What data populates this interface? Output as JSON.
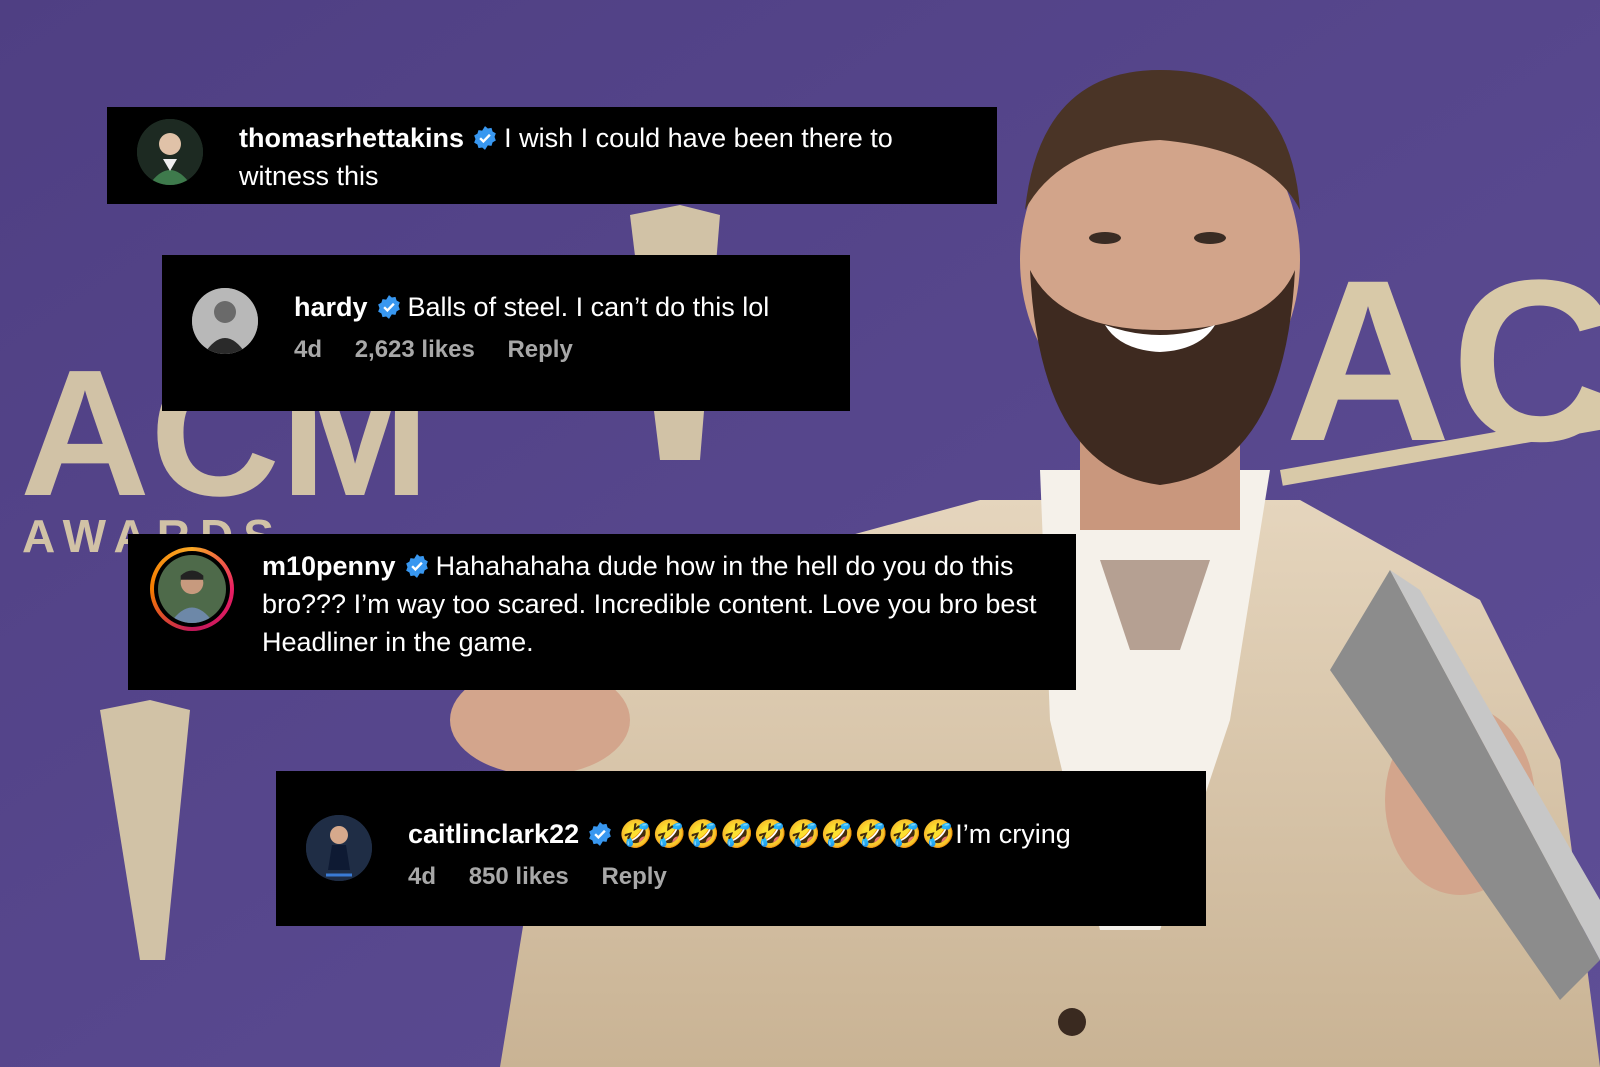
{
  "comments": [
    {
      "username": "thomasrhettakins",
      "text": "I wish I could have been there to witness this",
      "verified": true
    },
    {
      "username": "hardy",
      "text": "Balls of steel. I can’t do this lol",
      "verified": true,
      "time": "4d",
      "likes": "2,623 likes",
      "reply": "Reply"
    },
    {
      "username": "m10penny",
      "text": "Hahahahaha dude how in the hell do you do this bro??? I’m way too scared. Incredible content. Love you bro best Headliner in the game.",
      "verified": true,
      "story_ring": true
    },
    {
      "username": "caitlinclark22",
      "text": "🤣🤣🤣🤣🤣🤣🤣🤣🤣🤣I’m crying",
      "verified": true,
      "time": "4d",
      "likes": "850 likes",
      "reply": "Reply"
    }
  ],
  "background": {
    "logo_left": "ACM",
    "logo_left_sub": "AWARDS",
    "logo_right": "ACA",
    "colors": {
      "backdrop": "#5a4a8f",
      "logo": "#d8c9a8",
      "badge": "#3897f0"
    }
  }
}
